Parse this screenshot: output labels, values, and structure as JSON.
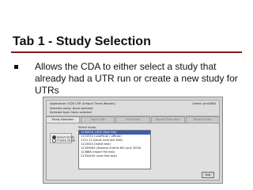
{
  "slide": {
    "title": "Tab 1 - Study Selection",
    "bullet": "Allows the CDA to either select a study that already had a UTR run or create a new study for UTRs"
  },
  "app": {
    "application_line": "Application: ICDS UTR (Unique Times Reports)",
    "user_line": "Userid: pnd1864",
    "selected_study_line": "Selected study: None selected",
    "selected_type_line": "Selected type: None selected",
    "tabs": [
      {
        "label": "Study Selection",
        "active": true
      },
      {
        "label": "Input Cats",
        "active": false
      },
      {
        "label": "View Data",
        "active": false
      },
      {
        "label": "Report Execution",
        "active": false
      },
      {
        "label": "Report Index",
        "active": false
      }
    ],
    "options": [
      {
        "label": "Select study",
        "selected": true
      },
      {
        "label": "Create study",
        "selected": false
      }
    ],
    "select_study_label": "Select study:",
    "studies": [
      "1234554_1455 (Text File)",
      "1115552 (unofficial / official)",
      "1121 12 (psuis incorrect test)",
      "1223444 (latest test)",
      "12345684 (Adverse Events 8th june 2004)",
      "123888 (report file test)",
      "22334445 (new first test)"
    ],
    "selected_study_index": 0,
    "exit_label": "Exit"
  }
}
